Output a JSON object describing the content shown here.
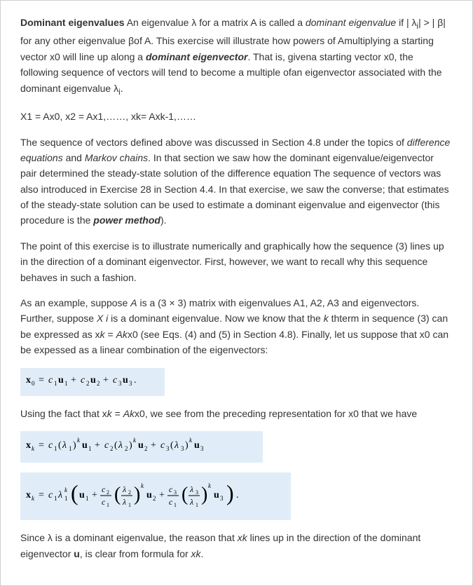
{
  "p1": {
    "lead": "Dominant eigenvalues",
    "t1": " An eigenvalue λ for a matrix A is called a ",
    "em1": "dominant eigenvalue",
    "t2": " if | λ",
    "sub_i": "i",
    "t2b": "| > | β| for any other eigenvalue βof A. This exercise will illustrate how powers of Amultiplying a starting vector x0 will line up along a ",
    "em2": "dominant eigenvector",
    "t3": ". That is, givena starting vector x0, the following sequence of vectors will tend to become a multiple ofan eigenvector associated with the dominant eigenvalue λ",
    "sub_i2": "i",
    "t4": "."
  },
  "seq": "X1 = Ax0, x2 = Ax1,……, xk= Axk-1,……",
  "p2": {
    "t1": "The sequence of vectors defined above was discussed in Section 4.8 under the topics of ",
    "em1": "difference equations",
    "t2": " and ",
    "em2": "Markov chains",
    "t3": ". In that section we saw how the dominant eigenvalue/eigenvector pair determined the steady-state solution of the difference equation The sequence of vectors was also introduced in Exercise 28 in Section 4.4. In that exercise, we saw the converse; that estimates of the steady-state solution can be used to estimate a dominant eigenvalue and eigenvector (this procedure is the ",
    "em3": "power method",
    "t4": ")."
  },
  "p3": "The point of this exercise is to illustrate numerically and graphically how the sequence (3) lines up in the direction of a dominant eigenvector. First, however, we want to recall why this sequence behaves in such a fashion.",
  "p4": {
    "t1": "As an example, suppose ",
    "emA": "A",
    "t2": " is a (3 × 3) matrix with eigenvalues A1, A2, A3 and eigenvectors. Further, suppose ",
    "emXi": "X i",
    "t3": " is a dominant eigenvalue. Now we know that the ",
    "emk": "k",
    "t4": " thterm in sequence (3) can be expressed as x",
    "emk2": "k",
    "t5": " = ",
    "emAk": "Ak",
    "t6": "x0 (see Eqs. (4) and (5) in Section 4.8). Finally, let us suppose that x0 can be expessed as a linear combination of the eigenvectors:"
  },
  "p5": {
    "t1": "Using the fact that x",
    "emk": "k",
    "t2": " = ",
    "emAk": "Ak",
    "t3": "x0, we see from the preceding representation for x0 that we have"
  },
  "p6": {
    "t1": "Since λ is a dominant eigenvalue, the reason that ",
    "xk": "xk",
    "t2": " lines up in the direction of the dominant eigenvector ",
    "u": "u",
    "t3": ", is clear from formula for ",
    "xk2": "xk",
    "t4": "."
  }
}
